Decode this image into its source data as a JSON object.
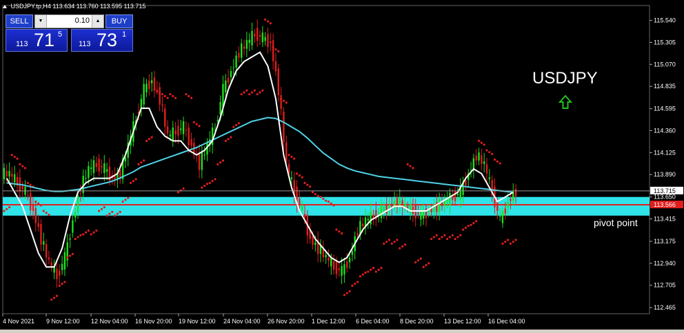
{
  "header": {
    "symbol_tf": "USDJPY.tp,H4",
    "ohlc": "113.634 113.760 113.595 113.715"
  },
  "trade_panel": {
    "sell_label": "SELL",
    "buy_label": "BUY",
    "lot": "0.10",
    "sell_small": "113",
    "sell_big": "71",
    "sell_sup": "5",
    "buy_small": "113",
    "buy_big": "73",
    "buy_sup": "1"
  },
  "annotations": {
    "symbol": "USDJPY",
    "pivot": "pivot point"
  },
  "colors": {
    "bull": "#1ee01e",
    "bear": "#e01e1e",
    "sar": "#e01e1e",
    "fast_ma": "#ffffff",
    "slow_ma": "#4fd3e6",
    "pivot_zone": "#2fe3e8",
    "arrow": "#1fc01f"
  },
  "chart_data": {
    "type": "candlestick",
    "y_ticks": [
      "115.540",
      "115.305",
      "115.070",
      "114.835",
      "114.595",
      "114.360",
      "114.125",
      "113.890",
      "113.650",
      "113.415",
      "113.175",
      "112.940",
      "112.705",
      "112.465"
    ],
    "x_ticks": [
      "4 Nov 2021",
      "9 Nov 12:00",
      "12 Nov 04:00",
      "16 Nov 20:00",
      "19 Nov 12:00",
      "24 Nov 04:00",
      "26 Nov 20:00",
      "1 Dec 12:00",
      "6 Dec 04:00",
      "8 Dec 20:00",
      "13 Dec 12:00",
      "16 Dec 04:00"
    ],
    "ylim": [
      112.4,
      115.7
    ],
    "current_price": 113.715,
    "current_price_label": "113.715",
    "pivot_line": 113.566,
    "pivot_line_label": "113.566",
    "pivot_zone": [
      113.45,
      113.65
    ],
    "close": [
      113.9,
      113.8,
      113.7,
      113.5,
      113.2,
      112.95,
      112.8,
      113.0,
      113.4,
      113.75,
      113.95,
      114.0,
      113.95,
      113.85,
      113.9,
      114.2,
      114.5,
      114.8,
      114.9,
      114.7,
      114.3,
      114.35,
      114.4,
      114.2,
      114.0,
      114.2,
      114.4,
      114.8,
      115.0,
      115.2,
      115.3,
      115.4,
      115.35,
      115.3,
      114.8,
      114.0,
      113.7,
      113.5,
      113.2,
      113.1,
      113.0,
      112.9,
      112.85,
      113.0,
      113.3,
      113.4,
      113.45,
      113.5,
      113.55,
      113.6,
      113.55,
      113.5,
      113.45,
      113.5,
      113.55,
      113.6,
      113.65,
      113.7,
      113.9,
      114.1,
      114.0,
      113.7,
      113.4,
      113.6,
      113.715
    ],
    "fast_ma": [
      113.85,
      113.7,
      113.55,
      113.3,
      113.05,
      112.9,
      112.9,
      113.1,
      113.45,
      113.7,
      113.8,
      113.85,
      113.85,
      113.85,
      113.9,
      114.1,
      114.35,
      114.6,
      114.6,
      114.4,
      114.3,
      114.25,
      114.25,
      114.15,
      114.1,
      114.15,
      114.25,
      114.5,
      114.8,
      115.0,
      115.1,
      115.15,
      115.2,
      115.05,
      114.7,
      114.1,
      113.75,
      113.5,
      113.35,
      113.2,
      113.1,
      113.0,
      112.95,
      113.0,
      113.15,
      113.3,
      113.4,
      113.45,
      113.5,
      113.55,
      113.55,
      113.5,
      113.5,
      113.5,
      113.55,
      113.6,
      113.65,
      113.7,
      113.85,
      113.95,
      113.9,
      113.75,
      113.6,
      113.65,
      113.7
    ],
    "slow_ma": [
      113.8,
      113.79,
      113.78,
      113.76,
      113.74,
      113.72,
      113.71,
      113.71,
      113.72,
      113.73,
      113.75,
      113.77,
      113.79,
      113.81,
      113.84,
      113.88,
      113.92,
      113.97,
      114.0,
      114.03,
      114.06,
      114.09,
      114.12,
      114.15,
      114.18,
      114.22,
      114.26,
      114.3,
      114.34,
      114.38,
      114.42,
      114.46,
      114.48,
      114.5,
      114.49,
      114.45,
      114.4,
      114.35,
      114.28,
      114.2,
      114.12,
      114.06,
      114.0,
      113.96,
      113.93,
      113.91,
      113.89,
      113.87,
      113.86,
      113.85,
      113.84,
      113.83,
      113.82,
      113.81,
      113.8,
      113.79,
      113.78,
      113.77,
      113.76,
      113.75,
      113.74,
      113.73,
      113.72,
      113.71,
      113.7
    ]
  }
}
